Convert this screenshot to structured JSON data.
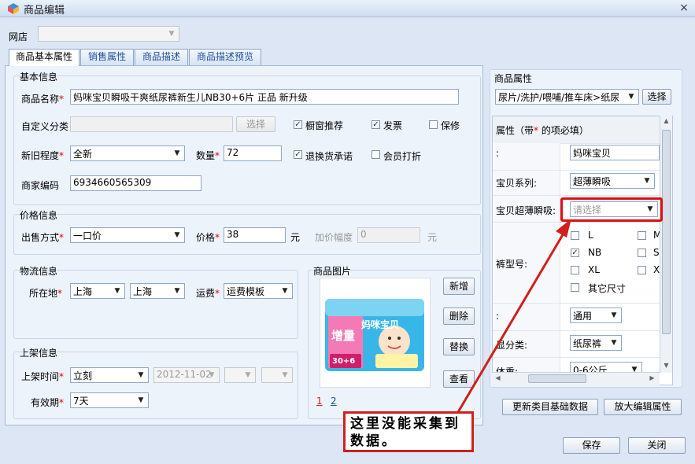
{
  "window": {
    "title": "商品编辑",
    "close": "×"
  },
  "store": {
    "label": "网店",
    "value": ""
  },
  "tabs": [
    "商品基本属性",
    "销售属性",
    "商品描述",
    "商品描述预览"
  ],
  "basic": {
    "title": "基本信息",
    "name_label": "商品名称",
    "name_value": "妈咪宝贝瞬吸干爽纸尿裤新生儿NB30+6片 正品 新升级",
    "custom_cat_label": "自定义分类",
    "select_btn": "选择",
    "chk_window": "橱窗推荐",
    "chk_invoice": "发票",
    "chk_warranty": "保修",
    "condition_label": "新旧程度",
    "condition_value": "全新",
    "qty_label": "数量",
    "qty_value": "72",
    "chk_return": "退换货承诺",
    "chk_member": "会员打折",
    "code_label": "商家编码",
    "code_value": "6934660565309"
  },
  "price": {
    "title": "价格信息",
    "mode_label": "出售方式",
    "mode_value": "一口价",
    "price_label": "价格",
    "price_value": "38",
    "unit": "元",
    "incr_label": "加价幅度",
    "incr_value": "0",
    "incr_unit": "元"
  },
  "logistics": {
    "title": "物流信息",
    "loc_label": "所在地",
    "province": "上海",
    "city": "上海",
    "fee_label": "运费",
    "fee_value": "运费模板"
  },
  "listing": {
    "title": "上架信息",
    "time_label": "上架时间",
    "time_value": "立刻",
    "date_value": "2012-11-02",
    "period_label": "有效期",
    "period_value": "7天"
  },
  "image": {
    "title": "商品图片",
    "btn_add": "新增",
    "btn_delete": "删除",
    "btn_replace": "替换",
    "btn_view": "查看",
    "pages": [
      "1",
      "2"
    ],
    "pkg_brand": "妈咪宝贝",
    "pkg_promo": "增量",
    "pkg_count": "30+6"
  },
  "attrs": {
    "title": "商品属性",
    "category": "尿片/洗护/喂哺/推车床>纸尿",
    "select_btn": "选择",
    "header_pre": "属性（带",
    "header_post": " 的项必填）",
    "rows": [
      {
        "label": ":",
        "value": "妈咪宝贝"
      },
      {
        "label": "宝贝系列:",
        "value": "超薄瞬吸"
      },
      {
        "label": "宝贝超薄瞬吸:",
        "value": "请选择"
      },
      {
        "label": "裤型号:",
        "value": ""
      },
      {
        "label": ":",
        "value": "通用"
      },
      {
        "label": "显分类:",
        "value": "纸尿裤"
      },
      {
        "label": "体重:",
        "value": "0-6公斤"
      }
    ],
    "sizes": [
      "L",
      "NB",
      "XL",
      "其它尺寸"
    ],
    "sizes_col2": [
      "M",
      "S",
      "X"
    ],
    "btn_update": "更新类目基础数据",
    "btn_zoom": "放大编辑属性"
  },
  "annotation": {
    "line1": "这里没能采集到",
    "line2": "数据。"
  },
  "footer": {
    "save": "保存",
    "close": "关闭"
  },
  "colors": {
    "accent": "#d0201c",
    "tab_text": "#1f4f9a"
  }
}
